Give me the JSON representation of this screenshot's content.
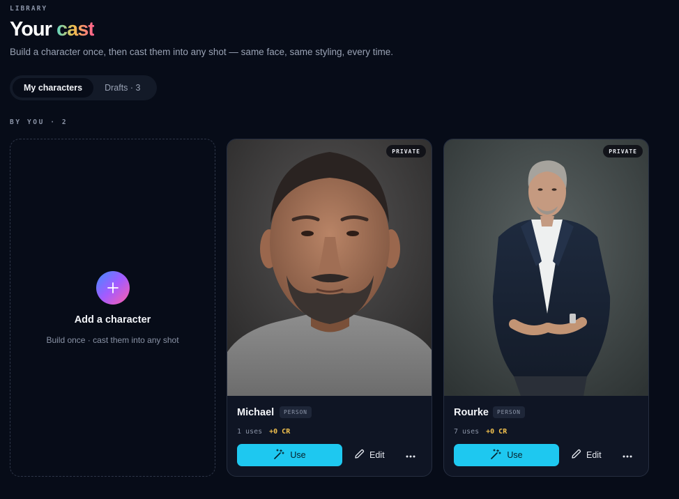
{
  "header": {
    "eyebrow": "LIBRARY",
    "title_plain": "Your",
    "title_accent": "cast",
    "subtitle": "Build a character once, then cast them into any shot — same face, same styling, every time."
  },
  "tabs": [
    {
      "label": "My characters",
      "active": true
    },
    {
      "label": "Drafts · 3",
      "active": false
    }
  ],
  "section": {
    "label": "BY YOU · 2"
  },
  "add_card": {
    "title": "Add a character",
    "subtitle": "Build once · cast them into any shot",
    "icon": "plus-icon"
  },
  "characters": [
    {
      "name": "Michael",
      "type": "PERSON",
      "visibility": "PRIVATE",
      "uses": "1 uses",
      "credits": "+0 CR",
      "use_label": "Use",
      "edit_label": "Edit"
    },
    {
      "name": "Rourke",
      "type": "PERSON",
      "visibility": "PRIVATE",
      "uses": "7 uses",
      "credits": "+0 CR",
      "use_label": "Use",
      "edit_label": "Edit"
    }
  ],
  "colors": {
    "background": "#070c18",
    "accent_cyan": "#1ec8f0",
    "credit_yellow": "#f2c14e"
  }
}
